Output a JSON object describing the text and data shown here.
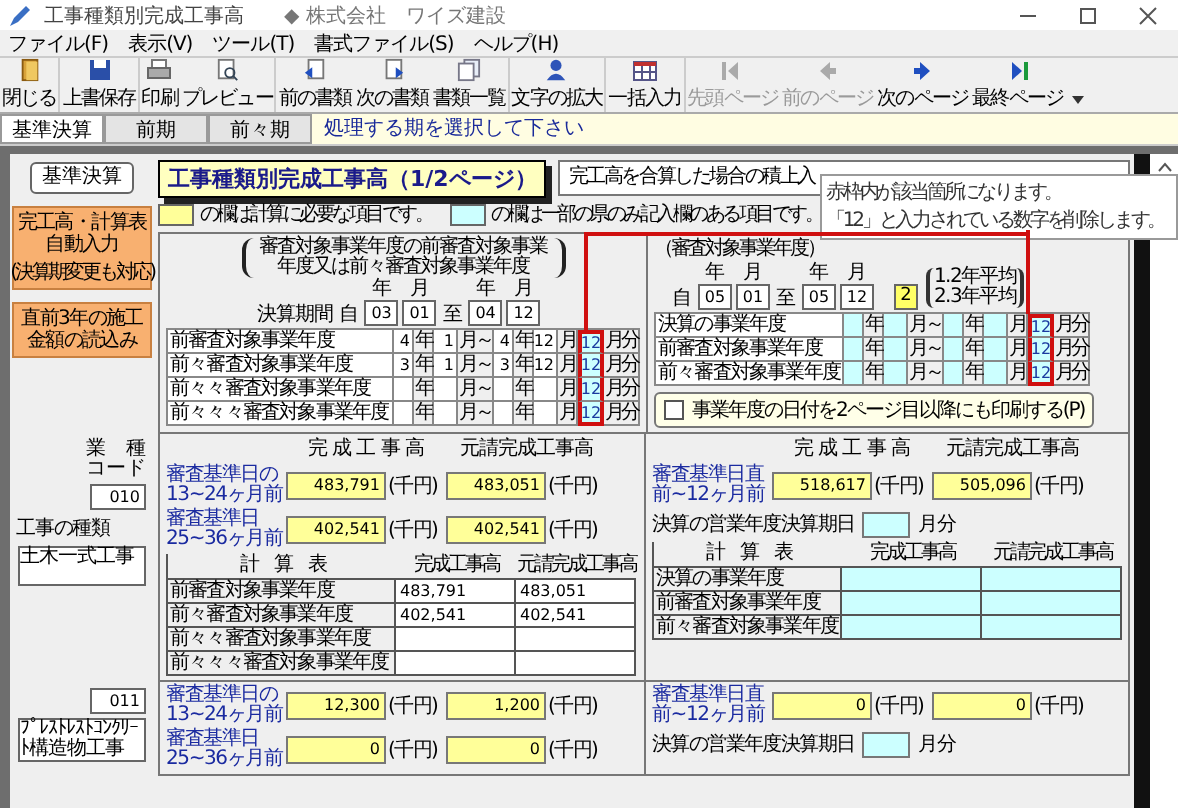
{
  "window": {
    "title": "工事種類別完成工事高",
    "company": "◆ 株式会社　ワイズ建設"
  },
  "menu": [
    "ファイル(F)",
    "表示(V)",
    "ツール(T)",
    "書式ファイル(S)",
    "ヘルプ(H)"
  ],
  "toolbar": [
    {
      "label": "閉じる",
      "kind": "door",
      "disabled": false,
      "separator_after": true
    },
    {
      "label": "上書保存",
      "kind": "save",
      "disabled": false,
      "separator_after": true
    },
    {
      "label": "印刷",
      "kind": "print",
      "disabled": false,
      "separator_after": false
    },
    {
      "label": "プレビュー",
      "kind": "preview",
      "disabled": false,
      "separator_after": true
    },
    {
      "label": "前の書類",
      "kind": "prevdoc",
      "disabled": false,
      "separator_after": false
    },
    {
      "label": "次の書類",
      "kind": "nextdoc",
      "disabled": false,
      "separator_after": false
    },
    {
      "label": "書類一覧",
      "kind": "list",
      "disabled": false,
      "separator_after": true
    },
    {
      "label": "文字の拡大",
      "kind": "zoom",
      "disabled": false,
      "separator_after": true
    },
    {
      "label": "一括入力",
      "kind": "batch",
      "disabled": false,
      "separator_after": true
    },
    {
      "label": "先頭ページ",
      "kind": "first",
      "disabled": true,
      "separator_after": false
    },
    {
      "label": "前のページ",
      "kind": "prev",
      "disabled": true,
      "separator_after": false
    },
    {
      "label": "次のページ",
      "kind": "next",
      "disabled": false,
      "separator_after": false
    },
    {
      "label": "最終ページ",
      "kind": "last",
      "disabled": false,
      "separator_after": false
    }
  ],
  "period_tabs": [
    {
      "label": "基準決算",
      "selected": true
    },
    {
      "label": "前期",
      "selected": false
    },
    {
      "label": "前々期",
      "selected": false
    }
  ],
  "period_hint": "処理する期を選択して下さい",
  "side": {
    "mode": "基準決算",
    "buttons": [
      {
        "label": "完工高・計算表自動入力",
        "note": "(決算期変更も対応)"
      },
      {
        "label": "直前3年の施工金額の読込み"
      }
    ]
  },
  "form_title": "工事種類別完成工事高（1/2ページ）",
  "sum_option": "完工高を合算した場合の積上入",
  "legend": [
    {
      "color": "#ffff99",
      "text": "の欄は計算に必要な項目です。"
    },
    {
      "color": "#ccffff",
      "text": "の欄は一部の県のみ記入欄のある項目です。"
    }
  ],
  "prior_period": {
    "heading": "審査対象事業年度の前審査対象事業年度又は前々審査対象事業年度",
    "ym_labels": [
      "年",
      "月",
      "年",
      "月"
    ],
    "range": {
      "label": "決算期間",
      "from": "自",
      "from_year": "03",
      "from_month": "01",
      "to": "至",
      "to_year": "04",
      "to_month": "12"
    },
    "highlight": true,
    "rows": [
      {
        "label": "前審査対象事業年度",
        "from_year": "4",
        "from_month": "1",
        "to_year": "4",
        "to_month": "12",
        "months": "12",
        "units": [
          "年",
          "月～",
          "年",
          "月",
          "月分"
        ]
      },
      {
        "label": "前々審査対象事業年度",
        "from_year": "3",
        "from_month": "1",
        "to_year": "3",
        "to_month": "12",
        "months": "12",
        "units": [
          "年",
          "月～",
          "年",
          "月",
          "月分"
        ]
      },
      {
        "label": "前々々審査対象事業年度",
        "months": "12",
        "units": [
          "年",
          "月～",
          "年",
          "月",
          "月分"
        ]
      },
      {
        "label": "前々々々審査対象事業年度",
        "months": "12",
        "units": [
          "年",
          "月～",
          "年",
          "月",
          "月分"
        ]
      }
    ]
  },
  "current_period": {
    "heading": "（審査対象事業年度）",
    "ym_labels": [
      "年",
      "月",
      "年",
      "月"
    ],
    "range": {
      "from": "自",
      "from_year": "05",
      "from_month": "01",
      "to": "至",
      "to_year": "05",
      "to_month": "12"
    },
    "average": {
      "value": "2",
      "options": [
        "1.2年平均",
        "2.3年平均"
      ]
    },
    "highlight": true,
    "rows": [
      {
        "label": "決算の事業年度",
        "months": "12",
        "units": [
          "年",
          "月～",
          "年",
          "月",
          "月分"
        ]
      },
      {
        "label": "前審査対象事業年度",
        "months": "12",
        "units": [
          "年",
          "月～",
          "年",
          "月",
          "月分"
        ]
      },
      {
        "label": "前々審査対象事業年度",
        "months": "12",
        "units": [
          "年",
          "月～",
          "年",
          "月",
          "月分"
        ]
      }
    ],
    "print_dates": {
      "label": "事業年度の日付を2ページ目以降にも印刷する(P)",
      "checked": false
    }
  },
  "callout": [
    "赤枠内が該当箇所になります。",
    "「12」と入力されている数字を削除します。"
  ],
  "code_label": "業　種コード",
  "sections": [
    {
      "code": "010",
      "type_label": "工事の種類",
      "type_name": "土木一式工事",
      "left": {
        "col_headers": [
          "完 成 工 事 高",
          "元請完成工事高"
        ],
        "inputs": [
          {
            "label": "審査基準日の13~24ヶ月前",
            "total": "483,791",
            "total_unit": "(千円)",
            "prime": "483,051",
            "prime_unit": "(千円)"
          },
          {
            "label": "審査基準日25~36ヶ月前",
            "total": "402,541",
            "total_unit": "(千円)",
            "prime": "402,541",
            "prime_unit": "(千円)"
          }
        ],
        "calc": {
          "headers": [
            "計　算　表",
            "完成工事高",
            "元請完成工事高"
          ],
          "rows": [
            {
              "label": "前審査対象事業年度",
              "total": "483,791",
              "prime": "483,051"
            },
            {
              "label": "前々審査対象事業年度",
              "total": "402,541",
              "prime": "402,541"
            },
            {
              "label": "前々々審査対象事業年度"
            },
            {
              "label": "前々々々審査対象事業年度"
            }
          ]
        }
      },
      "right": {
        "col_headers": [
          "完 成 工 事 高",
          "元請完成工事高"
        ],
        "inputs": [
          {
            "label": "審査基準日直前~12ヶ月前",
            "total": "518,617",
            "total_unit": "(千円)",
            "prime": "505,096",
            "prime_unit": "(千円)"
          }
        ],
        "closing": {
          "label": "決算の営業年度決算期日",
          "unit": "月分"
        },
        "calc": {
          "headers": [
            "計　算　表",
            "完成工事高",
            "元請完成工事高"
          ],
          "rows": [
            {
              "label": "決算の事業年度"
            },
            {
              "label": "前審査対象事業年度"
            },
            {
              "label": "前々審査対象事業年度"
            }
          ]
        }
      }
    },
    {
      "code": "011",
      "type_name": "ﾌﾟﾚｽﾄﾚｽﾄｺﾝｸﾘｰﾄ構造物工事",
      "left": {
        "inputs": [
          {
            "label": "審査基準日の13~24ヶ月前",
            "total": "12,300",
            "total_unit": "(千円)",
            "prime": "1,200",
            "prime_unit": "(千円)"
          },
          {
            "label": "審査基準日25~36ヶ月前",
            "total": "0",
            "total_unit": "(千円)",
            "prime": "0",
            "prime_unit": "(千円)"
          }
        ]
      },
      "right": {
        "inputs": [
          {
            "label": "審査基準日直前~12ヶ月前",
            "total": "0",
            "total_unit": "(千円)",
            "prime": "0",
            "prime_unit": "(千円)"
          }
        ],
        "closing": {
          "label": "決算の営業年度決算期日",
          "unit": "月分"
        }
      }
    }
  ]
}
